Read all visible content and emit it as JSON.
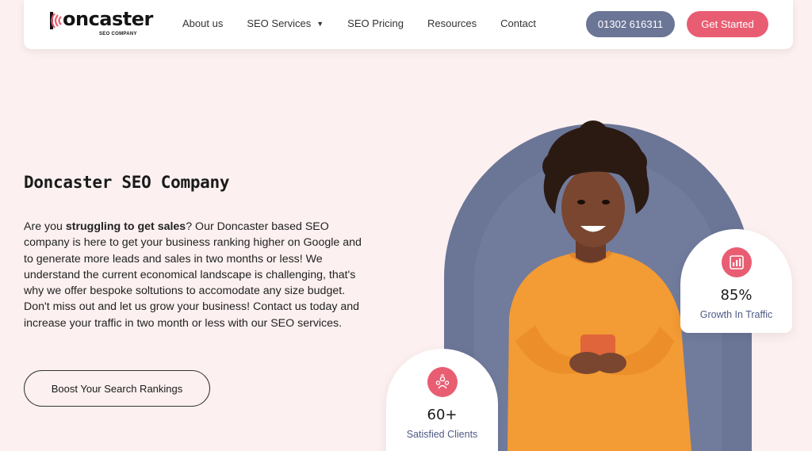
{
  "brand": {
    "name": "oncaster",
    "sub": "SEO COMPANY"
  },
  "nav": {
    "items": [
      {
        "label": "About us"
      },
      {
        "label": "SEO Services"
      },
      {
        "label": "SEO Pricing"
      },
      {
        "label": "Resources"
      },
      {
        "label": "Contact"
      }
    ],
    "phone": "01302 616311",
    "cta": "Get Started"
  },
  "hero": {
    "title": "Doncaster SEO Company",
    "desc_intro": "Are you ",
    "desc_bold": "struggling to get sales",
    "desc_rest": "? Our Doncaster based SEO company is here to get your business ranking higher on Google and to generate more leads and sales in two months or less! We understand the current economical landscape is challenging, that's why we offer bespoke soltutions to accomodate any size budget. Don't miss out and let us grow your business! Contact us today and increase your traffic in two month or less with our SEO services.",
    "button": "Boost Your Search Rankings"
  },
  "stats": {
    "traffic": {
      "value": "85%",
      "label": "Growth In Traffic",
      "icon": "bar-chart-icon"
    },
    "clients": {
      "value": "60+",
      "label": "Satisfied Clients",
      "icon": "team-icon"
    }
  },
  "colors": {
    "accent": "#e85d72",
    "slate": "#6b7596",
    "background": "#fcf0f0"
  }
}
